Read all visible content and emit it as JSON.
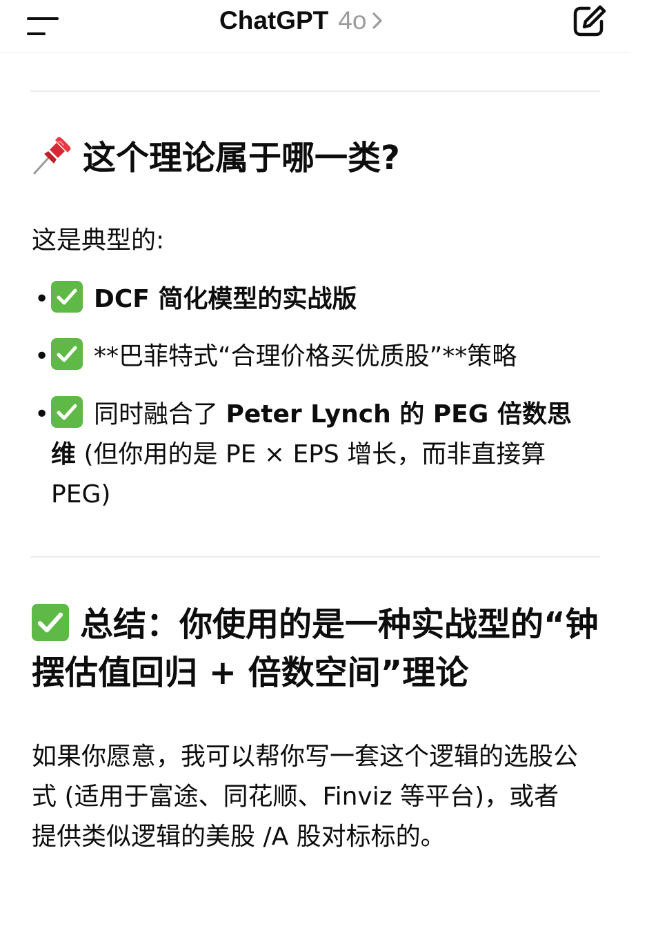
{
  "header": {
    "title": "ChatGPT",
    "model": "4o",
    "menu_icon": "menu-icon",
    "chevron_icon": "chevron-right-icon",
    "new_chat_icon": "compose-icon"
  },
  "section1": {
    "heading_icon": "pushpin-icon",
    "heading": "这个理论属于哪一类?",
    "intro": "这是典型的:",
    "bullets": [
      {
        "dot": "•",
        "icon": "check-icon",
        "text": "DCF 简化模型的实战版"
      },
      {
        "dot": "•",
        "icon": "check-icon",
        "text": "**巴菲特式“合理价格买优质股”**策略"
      },
      {
        "dot": "•",
        "icon": "check-icon",
        "text_pre": "同时融合了 ",
        "text_bold": "Peter Lynch 的 PEG 倍数思维",
        "text_post": " (但你用的是 PE × EPS 增长，而非直接算 PEG)"
      }
    ]
  },
  "section2": {
    "heading_icon": "check-icon",
    "heading": "总结：你使用的是一种实战型的“钟摆估值回归 + 倍数空间”理论",
    "body": "如果你愿意，我可以帮你写一套这个逻辑的选股公式 (适用于富途、同花顺、Finviz 等平台)，或者提供类似逻辑的美股 /A 股对标标的。"
  },
  "colors": {
    "check_green": "#5fb946",
    "text": "#0d0d0d",
    "model_grey": "#9b9b9b",
    "divider": "#ececec"
  }
}
